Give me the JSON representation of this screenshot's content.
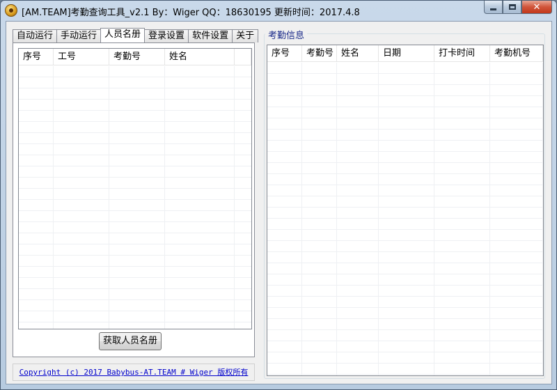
{
  "window": {
    "title": "[AM.TEAM]考勤查询工具_v2.1  By：Wiger QQ：18630195  更新时间：2017.4.8",
    "close_glyph": "✕"
  },
  "tabs": [
    {
      "label": "自动运行",
      "active": false
    },
    {
      "label": "手动运行",
      "active": false
    },
    {
      "label": "人员名册",
      "active": true
    },
    {
      "label": "登录设置",
      "active": false
    },
    {
      "label": "软件设置",
      "active": false
    },
    {
      "label": "关于",
      "active": false
    }
  ],
  "roster": {
    "columns": [
      "序号",
      "工号",
      "考勤号",
      "姓名"
    ],
    "rows": [],
    "fetch_button": "获取人员名册"
  },
  "footer": {
    "copyright": "Copyright (c) 2017 Babybus-AT.TEAM # Wiger 版权所有"
  },
  "attendance": {
    "group_title": "考勤信息",
    "columns": [
      "序号",
      "考勤号",
      "姓名",
      "日期",
      "打卡时间",
      "考勤机号"
    ],
    "rows": []
  }
}
